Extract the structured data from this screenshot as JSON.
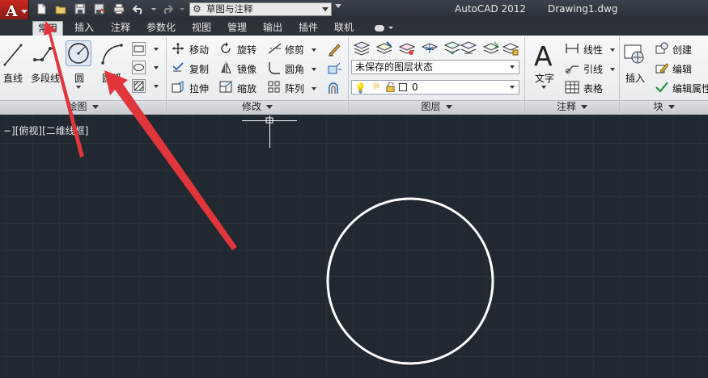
{
  "app_menu": {
    "letter": "A"
  },
  "workspace": {
    "value": "草图与注释"
  },
  "title": {
    "app": "AutoCAD 2012",
    "file": "Drawing1.dwg"
  },
  "tabs": [
    {
      "label": "常用",
      "active": true
    },
    {
      "label": "插入"
    },
    {
      "label": "注释"
    },
    {
      "label": "参数化"
    },
    {
      "label": "视图"
    },
    {
      "label": "管理"
    },
    {
      "label": "输出"
    },
    {
      "label": "插件"
    },
    {
      "label": "联机"
    }
  ],
  "draw_panel": {
    "title": "绘图",
    "tools": [
      "直线",
      "多段线",
      "圆",
      "圆弧"
    ]
  },
  "modify_panel": {
    "title": "修改",
    "tools": [
      "移动",
      "旋转",
      "修剪",
      "复制",
      "镜像",
      "圆角",
      "拉伸",
      "缩放",
      "阵列"
    ]
  },
  "layers_panel": {
    "title": "图层",
    "layer_state": "未保存的图层状态",
    "current_layer": "0"
  },
  "annotation_panel": {
    "title": "注释",
    "text_label": "文字",
    "tools": [
      "线性",
      "引线",
      "表格"
    ]
  },
  "block_panel": {
    "title": "块",
    "insert_label": "插入",
    "tools": [
      "创建",
      "编辑",
      "编辑属性"
    ]
  },
  "viewport": {
    "label": "−][俯视][二维线框]"
  },
  "colors": {
    "canvas": "#212830",
    "grid": "#2f3742",
    "arrow": "#e0353b",
    "circle": "#ffffff"
  }
}
